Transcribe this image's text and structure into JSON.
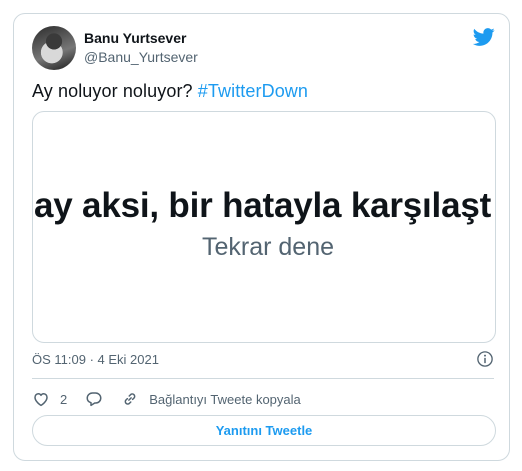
{
  "author": {
    "name": "Banu Yurtsever",
    "handle": "@Banu_Yurtsever"
  },
  "tweet": {
    "text": "Ay noluyor noluyor? ",
    "hashtag": "#TwitterDown"
  },
  "media": {
    "error_text": "ay aksi, bir hatayla karşılaşt",
    "retry_text": "Tekrar dene"
  },
  "meta": {
    "timestamp": "ÖS 11:09 · 4 Eki 2021"
  },
  "actions": {
    "like_count": "2",
    "copy_link_label": "Bağlantıyı Tweete kopyala"
  },
  "reply_button_label": "Yanıtını Tweetle",
  "colors": {
    "accent": "#1d9bf0",
    "text": "#0f1419",
    "secondary": "#536471",
    "border": "#cfd9de"
  },
  "icons": [
    "twitter-bird-icon",
    "info-icon",
    "heart-icon",
    "reply-icon",
    "link-icon"
  ]
}
